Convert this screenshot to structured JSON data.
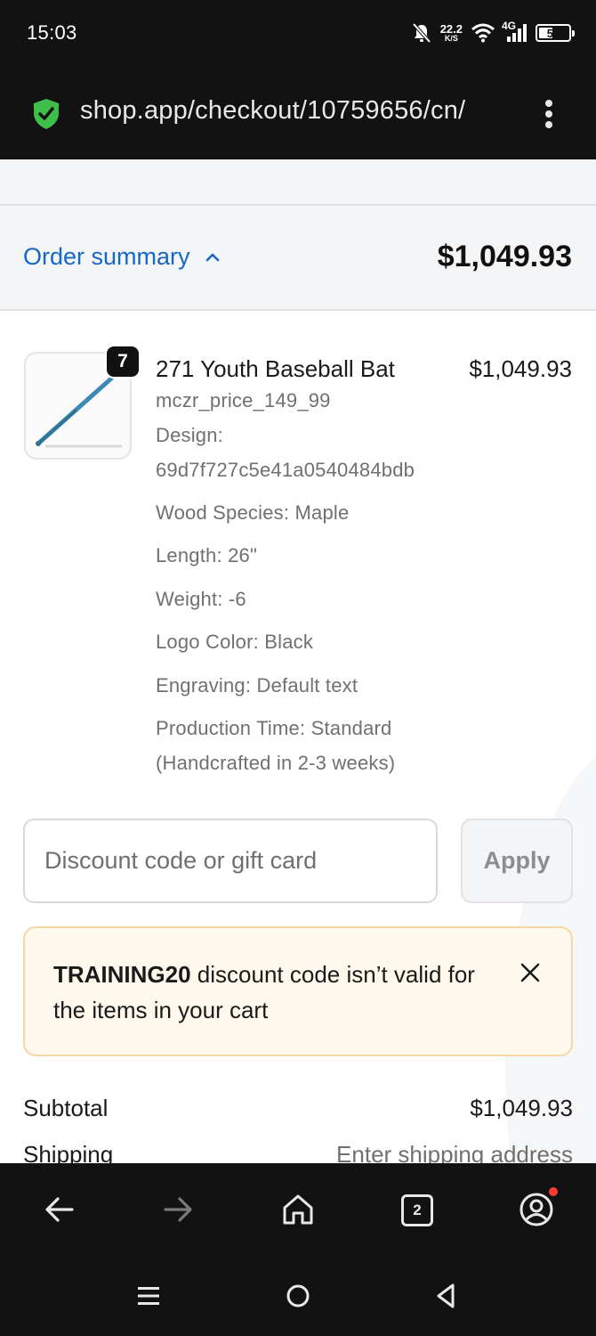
{
  "status_bar": {
    "time": "15:03",
    "net_speed_value": "22.2",
    "net_speed_unit": "K/S",
    "network_type": "4G",
    "battery_level": "54"
  },
  "browser": {
    "url": "shop.app/checkout/10759656/cn/",
    "tab_count": "2"
  },
  "order_summary": {
    "toggle_label": "Order summary",
    "total": "$1,049.93"
  },
  "product": {
    "quantity": "7",
    "name": "271 Youth Baseball Bat",
    "price": "$1,049.93",
    "variant": "mczr_price_149_99",
    "design_label": "Design:",
    "design_value": "69d7f727c5e41a0540484bdb",
    "wood_species": "Wood Species: Maple",
    "length": "Length: 26\"",
    "weight": "Weight: -6",
    "logo_color": "Logo Color: Black",
    "engraving": "Engraving: Default text",
    "production_time_line1": "Production Time: Standard",
    "production_time_line2": "(Handcrafted in 2-3 weeks)"
  },
  "discount": {
    "placeholder": "Discount code or gift card",
    "apply_label": "Apply"
  },
  "alert": {
    "code": "TRAINING20",
    "message": " discount code isn’t valid for the items in your cart"
  },
  "totals": {
    "subtotal_label": "Subtotal",
    "subtotal_value": "$1,049.93",
    "shipping_label": "Shipping",
    "shipping_value": "Enter shipping address"
  },
  "colors": {
    "link_blue": "#1667c7",
    "alert_bg": "#fff8ec",
    "alert_border": "#f6d6a5",
    "shield_green": "#3fbf4a",
    "notification_dot": "#ff3b30"
  }
}
